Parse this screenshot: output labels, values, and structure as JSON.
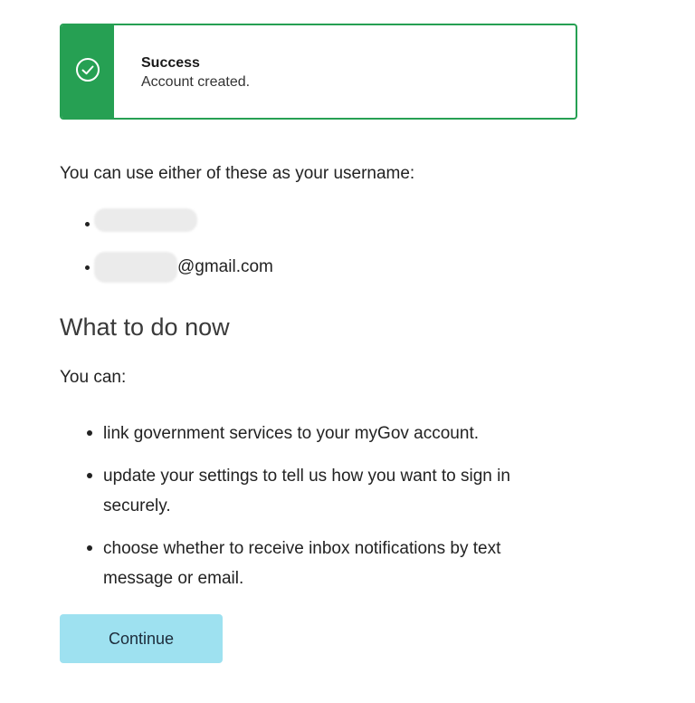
{
  "alert": {
    "icon": "check-circle-icon",
    "accent_color": "#26a053",
    "title": "Success",
    "message": "Account created."
  },
  "intro_text": "You can use either of these as your username:",
  "usernames": [
    {
      "prefix_redacted": true,
      "suffix": ""
    },
    {
      "prefix_redacted": true,
      "suffix": "@gmail.com"
    }
  ],
  "next_steps": {
    "heading": "What to do now",
    "lead": "You can:",
    "items": [
      "link government services to your myGov account.",
      "update your settings to tell us how you want to sign in securely.",
      "choose whether to receive inbox notifications by text message or email."
    ]
  },
  "continue_button": {
    "label": "Continue",
    "background_color": "#9ee1f0"
  }
}
